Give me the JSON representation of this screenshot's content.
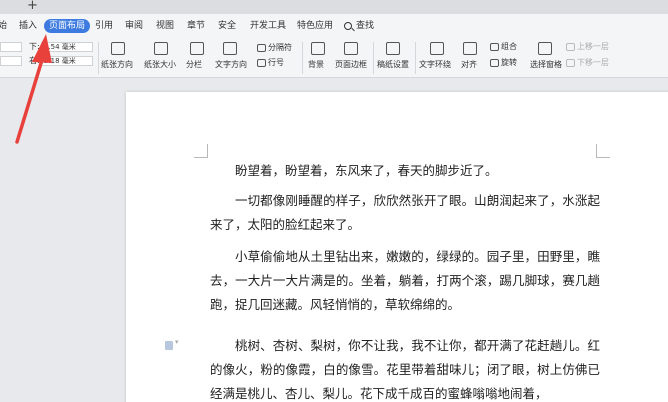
{
  "tabbar": {
    "new_tab": "+"
  },
  "menubar": {
    "items": [
      {
        "label": "始",
        "active": false
      },
      {
        "label": "插入",
        "active": false
      },
      {
        "label": "页面布局",
        "active": true
      },
      {
        "label": "引用",
        "active": false
      },
      {
        "label": "审阅",
        "active": false
      },
      {
        "label": "视图",
        "active": false
      },
      {
        "label": "章节",
        "active": false
      },
      {
        "label": "安全",
        "active": false
      },
      {
        "label": "开发工具",
        "active": false
      },
      {
        "label": "特色应用",
        "active": false
      }
    ],
    "search_label": "查找"
  },
  "ribbon": {
    "margin_bottom_label": "下:",
    "margin_bottom_value": "2.54 毫米",
    "margin_right_label": "右:",
    "margin_right_value": "3.18 毫米",
    "paper_orientation": "纸张方向",
    "paper_size": "纸张大小",
    "columns": "分栏",
    "text_direction": "文字方向",
    "separator": "分隔符",
    "line_number": "行号",
    "background": "背景",
    "page_border": "页面边框",
    "manuscript": "稿纸设置",
    "text_wrap": "文字环绕",
    "align": "对齐",
    "group": "组合",
    "rotate": "旋转",
    "selection_pane": "选择窗格",
    "bring_forward": "上移一层",
    "send_backward": "下移一层"
  },
  "document": {
    "paragraphs": [
      "盼望着，盼望着，东风来了，春天的脚步近了。",
      "一切都像刚睡醒的样子，欣欣然张开了眼。山朗润起来了，水涨起来了，太阳的脸红起来了。",
      "小草偷偷地从土里钻出来，嫩嫩的，绿绿的。园子里，田野里，瞧去，一大片一大片满是的。坐着，躺着，打两个滚，踢几脚球，赛几趟跑，捉几回迷藏。风轻悄悄的，草软绵绵的。",
      "桃树、杏树、梨树，你不让我，我不让你，都开满了花赶趟儿。红的像火，粉的像霞，白的像雪。花里带着甜味儿；闭了眼，树上仿佛已经满是桃儿、杏儿、梨儿。花下成千成百的蜜蜂嗡嗡地闹着，"
    ]
  },
  "colors": {
    "active_tab": "#3d7be0",
    "annotation_arrow": "#e8413c"
  }
}
